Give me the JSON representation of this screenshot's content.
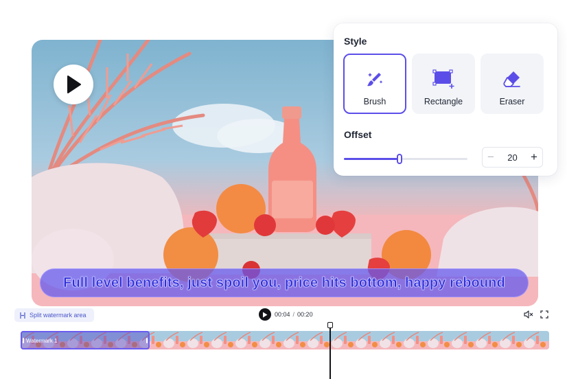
{
  "subtitle": "Full level benefits, just spoil you, price hits bottom, happy rebound",
  "style_panel": {
    "style_title": "Style",
    "tools": [
      {
        "label": "Brush",
        "icon": "brush-icon",
        "active": true
      },
      {
        "label": "Rectangle",
        "icon": "rectangle-select-icon",
        "active": false
      },
      {
        "label": "Eraser",
        "icon": "eraser-icon",
        "active": false
      }
    ],
    "offset_title": "Offset",
    "offset_value": "20",
    "slider_fraction": 0.45,
    "minus_label": "−",
    "plus_label": "+"
  },
  "timeline": {
    "split_label": "Split watermark area",
    "current_time": "00:04",
    "separator": "/",
    "total_time": "00:20",
    "watermark_clip_label": "Watermark 1"
  },
  "colors": {
    "accent": "#5b4ee8",
    "subtitle_bg": "#6258f0",
    "subtitle_text": "#2c2ad8"
  }
}
